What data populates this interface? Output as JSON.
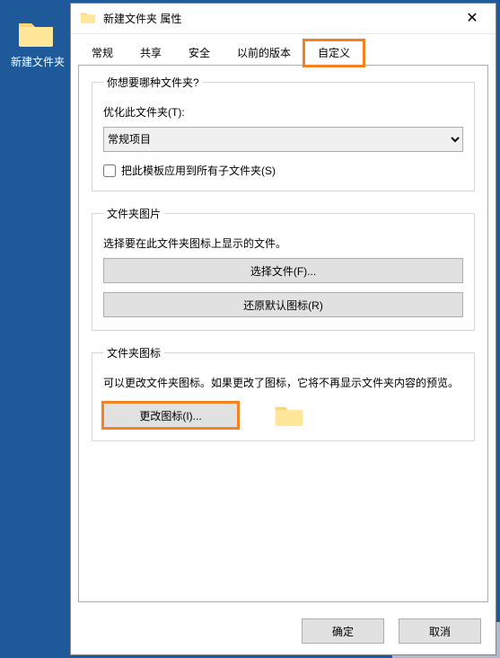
{
  "desktop": {
    "icon_name": "folder-icon",
    "label": "新建文件夹"
  },
  "dialog": {
    "title": "新建文件夹 属性",
    "close_label": "✕",
    "tabs": {
      "general": "常规",
      "sharing": "共享",
      "security": "安全",
      "previous": "以前的版本",
      "customize": "自定义"
    },
    "section_kind": {
      "legend": "你想要哪种文件夹?",
      "optimize_label": "优化此文件夹(T):",
      "combo_value": "常规项目",
      "checkbox_label": "把此模板应用到所有子文件夹(S)"
    },
    "section_picture": {
      "legend": "文件夹图片",
      "description": "选择要在此文件夹图标上显示的文件。",
      "choose_btn": "选择文件(F)...",
      "restore_btn": "还原默认图标(R)"
    },
    "section_icon": {
      "legend": "文件夹图标",
      "description": "可以更改文件夹图标。如果更改了图标，它将不再显示文件夹内容的预览。",
      "change_btn": "更改图标(I)..."
    },
    "footer": {
      "ok": "确定",
      "cancel": "取消"
    }
  }
}
